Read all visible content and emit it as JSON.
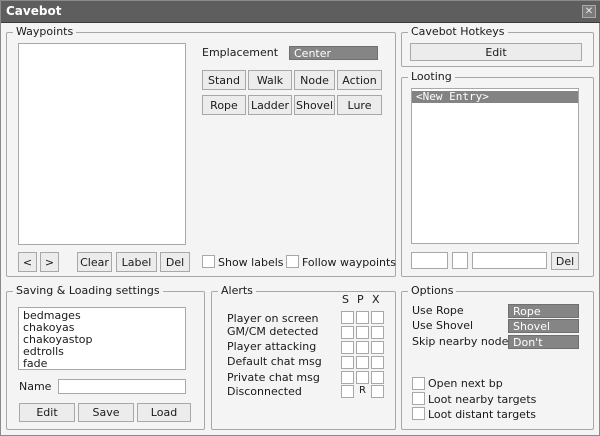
{
  "window": {
    "title": "Cavebot",
    "close_glyph": "✕"
  },
  "waypoints": {
    "group_title": "Waypoints",
    "emplacement_label": "Emplacement",
    "emplacement_value": "Center",
    "buttons_row1": [
      "Stand",
      "Walk",
      "Node",
      "Action"
    ],
    "buttons_row2": [
      "Rope",
      "Ladder",
      "Shovel",
      "Lure"
    ],
    "prev_glyph": "<",
    "next_glyph": ">",
    "clear_label": "Clear",
    "label_label": "Label",
    "del_label": "Del",
    "show_labels": "Show labels",
    "follow_waypoints": "Follow waypoints"
  },
  "hotkeys": {
    "group_title": "Cavebot Hotkeys",
    "edit_label": "Edit"
  },
  "looting": {
    "group_title": "Looting",
    "items": [
      "<New Entry>"
    ],
    "del_label": "Del"
  },
  "saving": {
    "group_title": "Saving & Loading settings",
    "files": [
      "bedmages",
      "chakoyas",
      "chakoyastop",
      "edtrolls",
      "fade"
    ],
    "name_label": "Name",
    "edit_label": "Edit",
    "save_label": "Save",
    "load_label": "Load"
  },
  "alerts": {
    "group_title": "Alerts",
    "col_s": "S",
    "col_p": "P",
    "col_x": "X",
    "rows": [
      {
        "label": "Player on screen",
        "p": ""
      },
      {
        "label": "GM/CM detected",
        "p": ""
      },
      {
        "label": "Player attacking",
        "p": ""
      },
      {
        "label": "Default chat msg",
        "p": ""
      },
      {
        "label": "Private chat msg",
        "p": ""
      },
      {
        "label": "Disconnected",
        "p": "R"
      }
    ]
  },
  "options": {
    "group_title": "Options",
    "use_rope_label": "Use Rope",
    "use_rope_value": "Rope",
    "use_shovel_label": "Use Shovel",
    "use_shovel_value": "Shovel",
    "skip_nodes_label": "Skip nearby nodes",
    "skip_nodes_value": "Don't",
    "open_next_bp": "Open next bp",
    "loot_nearby": "Loot nearby targets",
    "loot_distant": "Loot distant targets"
  }
}
